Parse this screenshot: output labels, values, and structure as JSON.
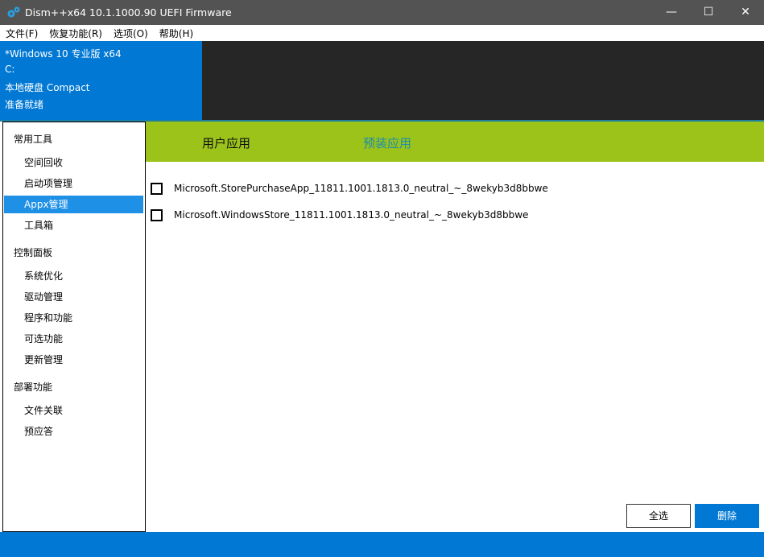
{
  "window": {
    "title": "Dism++x64 10.1.1000.90 UEFI Firmware",
    "minimize": "—",
    "maximize": "☐",
    "close": "✕"
  },
  "menu": [
    "文件(F)",
    "恢复功能(R)",
    "选项(O)",
    "帮助(H)"
  ],
  "info": [
    "*Windows 10 专业版 x64",
    "C:",
    "本地硬盘 Compact",
    "准备就绪"
  ],
  "sidebar": {
    "sections": [
      {
        "label": "常用工具",
        "items": [
          "空间回收",
          "启动项管理",
          "Appx管理",
          "工具箱"
        ]
      },
      {
        "label": "控制面板",
        "items": [
          "系统优化",
          "驱动管理",
          "程序和功能",
          "可选功能",
          "更新管理"
        ]
      },
      {
        "label": "部署功能",
        "items": [
          "文件关联",
          "预应答"
        ]
      }
    ],
    "selected": "Appx管理"
  },
  "tabs": {
    "user": "用户应用",
    "preinstalled": "预装应用"
  },
  "apps": [
    "Microsoft.StorePurchaseApp_11811.1001.1813.0_neutral_~_8wekyb3d8bbwe",
    "Microsoft.WindowsStore_11811.1001.1813.0_neutral_~_8wekyb3d8bbwe"
  ],
  "buttons": {
    "select_all": "全选",
    "delete": "删除"
  },
  "colors": {
    "accent": "#0078d4",
    "tabbar": "#9bc31a",
    "active_tab": "#1e8fa8"
  }
}
